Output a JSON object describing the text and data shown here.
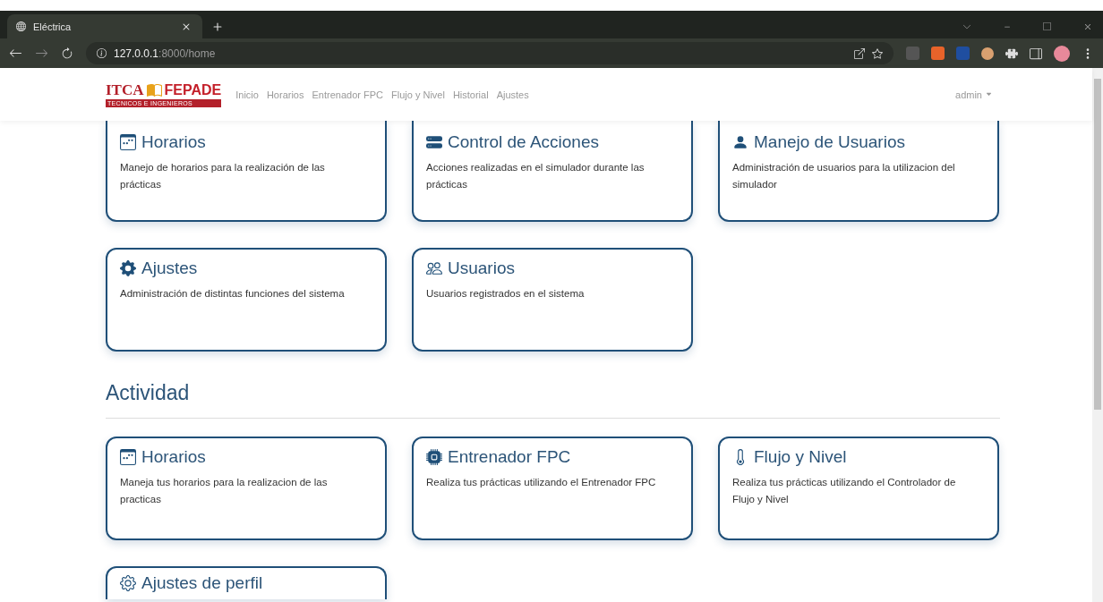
{
  "browser": {
    "tab_title": "Eléctrica",
    "url_host": "127.0.0.1",
    "url_path": ":8000/home"
  },
  "navbar": {
    "logo_main": "ITCA",
    "logo_brand": "FEPADE",
    "logo_tagline": "TECNICOS E INGENIEROS",
    "links": [
      {
        "label": "Inicio"
      },
      {
        "label": "Horarios"
      },
      {
        "label": "Entrenador FPC"
      },
      {
        "label": "Flujo y Nivel"
      },
      {
        "label": "Historial"
      },
      {
        "label": "Ajustes"
      }
    ],
    "user": "admin"
  },
  "sections": [
    {
      "cards": [
        {
          "title": "Horarios",
          "description": "Manejo de horarios para la realización de las prácticas"
        },
        {
          "title": "Control de Acciones",
          "description": "Acciones realizadas en el simulador durante las prácticas"
        },
        {
          "title": "Manejo de Usuarios",
          "description": "Administración de usuarios para la utilizacion del simulador"
        },
        {
          "title": "Ajustes",
          "description": "Administración de distintas funciones del sistema"
        },
        {
          "title": "Usuarios",
          "description": "Usuarios registrados en el sistema"
        }
      ]
    },
    {
      "heading": "Actividad",
      "cards": [
        {
          "title": "Horarios",
          "description": "Maneja tus horarios para la realizacion de las practicas"
        },
        {
          "title": "Entrenador FPC",
          "description": "Realiza tus prácticas utilizando el Entrenador FPC"
        },
        {
          "title": "Flujo y Nivel",
          "description": "Realiza tus prácticas utilizando el Controlador de Flujo y Nivel"
        },
        {
          "title": "Ajustes de perfil"
        }
      ]
    }
  ]
}
